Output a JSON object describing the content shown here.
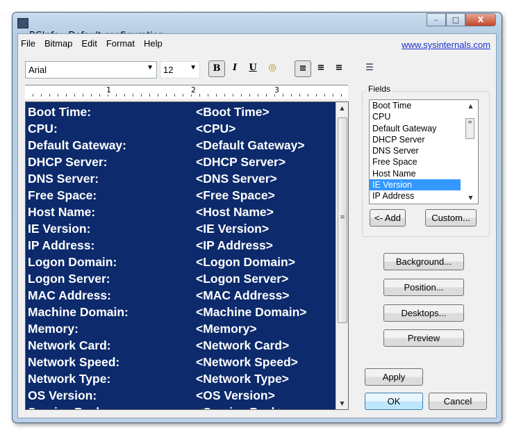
{
  "window": {
    "title": "BGInfo - Default configuration",
    "minimize": "–",
    "maximize": "□",
    "close": "X"
  },
  "menu": [
    "File",
    "Bitmap",
    "Edit",
    "Format",
    "Help"
  ],
  "link": "www.sysinternals.com",
  "toolbar": {
    "font": "Arial",
    "size": "12",
    "bold": "B",
    "italic": "I",
    "underline": "U"
  },
  "ruler": {
    "marks": [
      "1",
      "2",
      "3"
    ]
  },
  "editor": {
    "rows": [
      [
        "Boot Time:",
        "<Boot Time>"
      ],
      [
        "CPU:",
        "<CPU>"
      ],
      [
        "Default Gateway:",
        "<Default Gateway>"
      ],
      [
        "DHCP Server:",
        "<DHCP Server>"
      ],
      [
        "DNS Server:",
        "<DNS Server>"
      ],
      [
        "Free Space:",
        "<Free Space>"
      ],
      [
        "Host Name:",
        "<Host Name>"
      ],
      [
        "IE Version:",
        "<IE Version>"
      ],
      [
        "IP Address:",
        "<IP Address>"
      ],
      [
        "Logon Domain:",
        "<Logon Domain>"
      ],
      [
        "Logon Server:",
        "<Logon Server>"
      ],
      [
        "MAC Address:",
        "<MAC Address>"
      ],
      [
        "Machine Domain:",
        "<Machine Domain>"
      ],
      [
        "Memory:",
        "<Memory>"
      ],
      [
        "Network Card:",
        "<Network Card>"
      ],
      [
        "Network Speed:",
        "<Network Speed>"
      ],
      [
        "Network Type:",
        "<Network Type>"
      ],
      [
        "OS Version:",
        "<OS Version>"
      ],
      [
        "Service Pack:",
        "<Service Pack>"
      ]
    ]
  },
  "fields": {
    "label": "Fields",
    "items": [
      "Boot Time",
      "CPU",
      "Default Gateway",
      "DHCP Server",
      "DNS Server",
      "Free Space",
      "Host Name",
      "IE Version",
      "IP Address"
    ],
    "selected": "IE Version",
    "add": "<- Add",
    "custom": "Custom..."
  },
  "buttons": {
    "background": "Background...",
    "position": "Position...",
    "desktops": "Desktops...",
    "preview": "Preview",
    "apply": "Apply",
    "ok": "OK",
    "cancel": "Cancel"
  }
}
